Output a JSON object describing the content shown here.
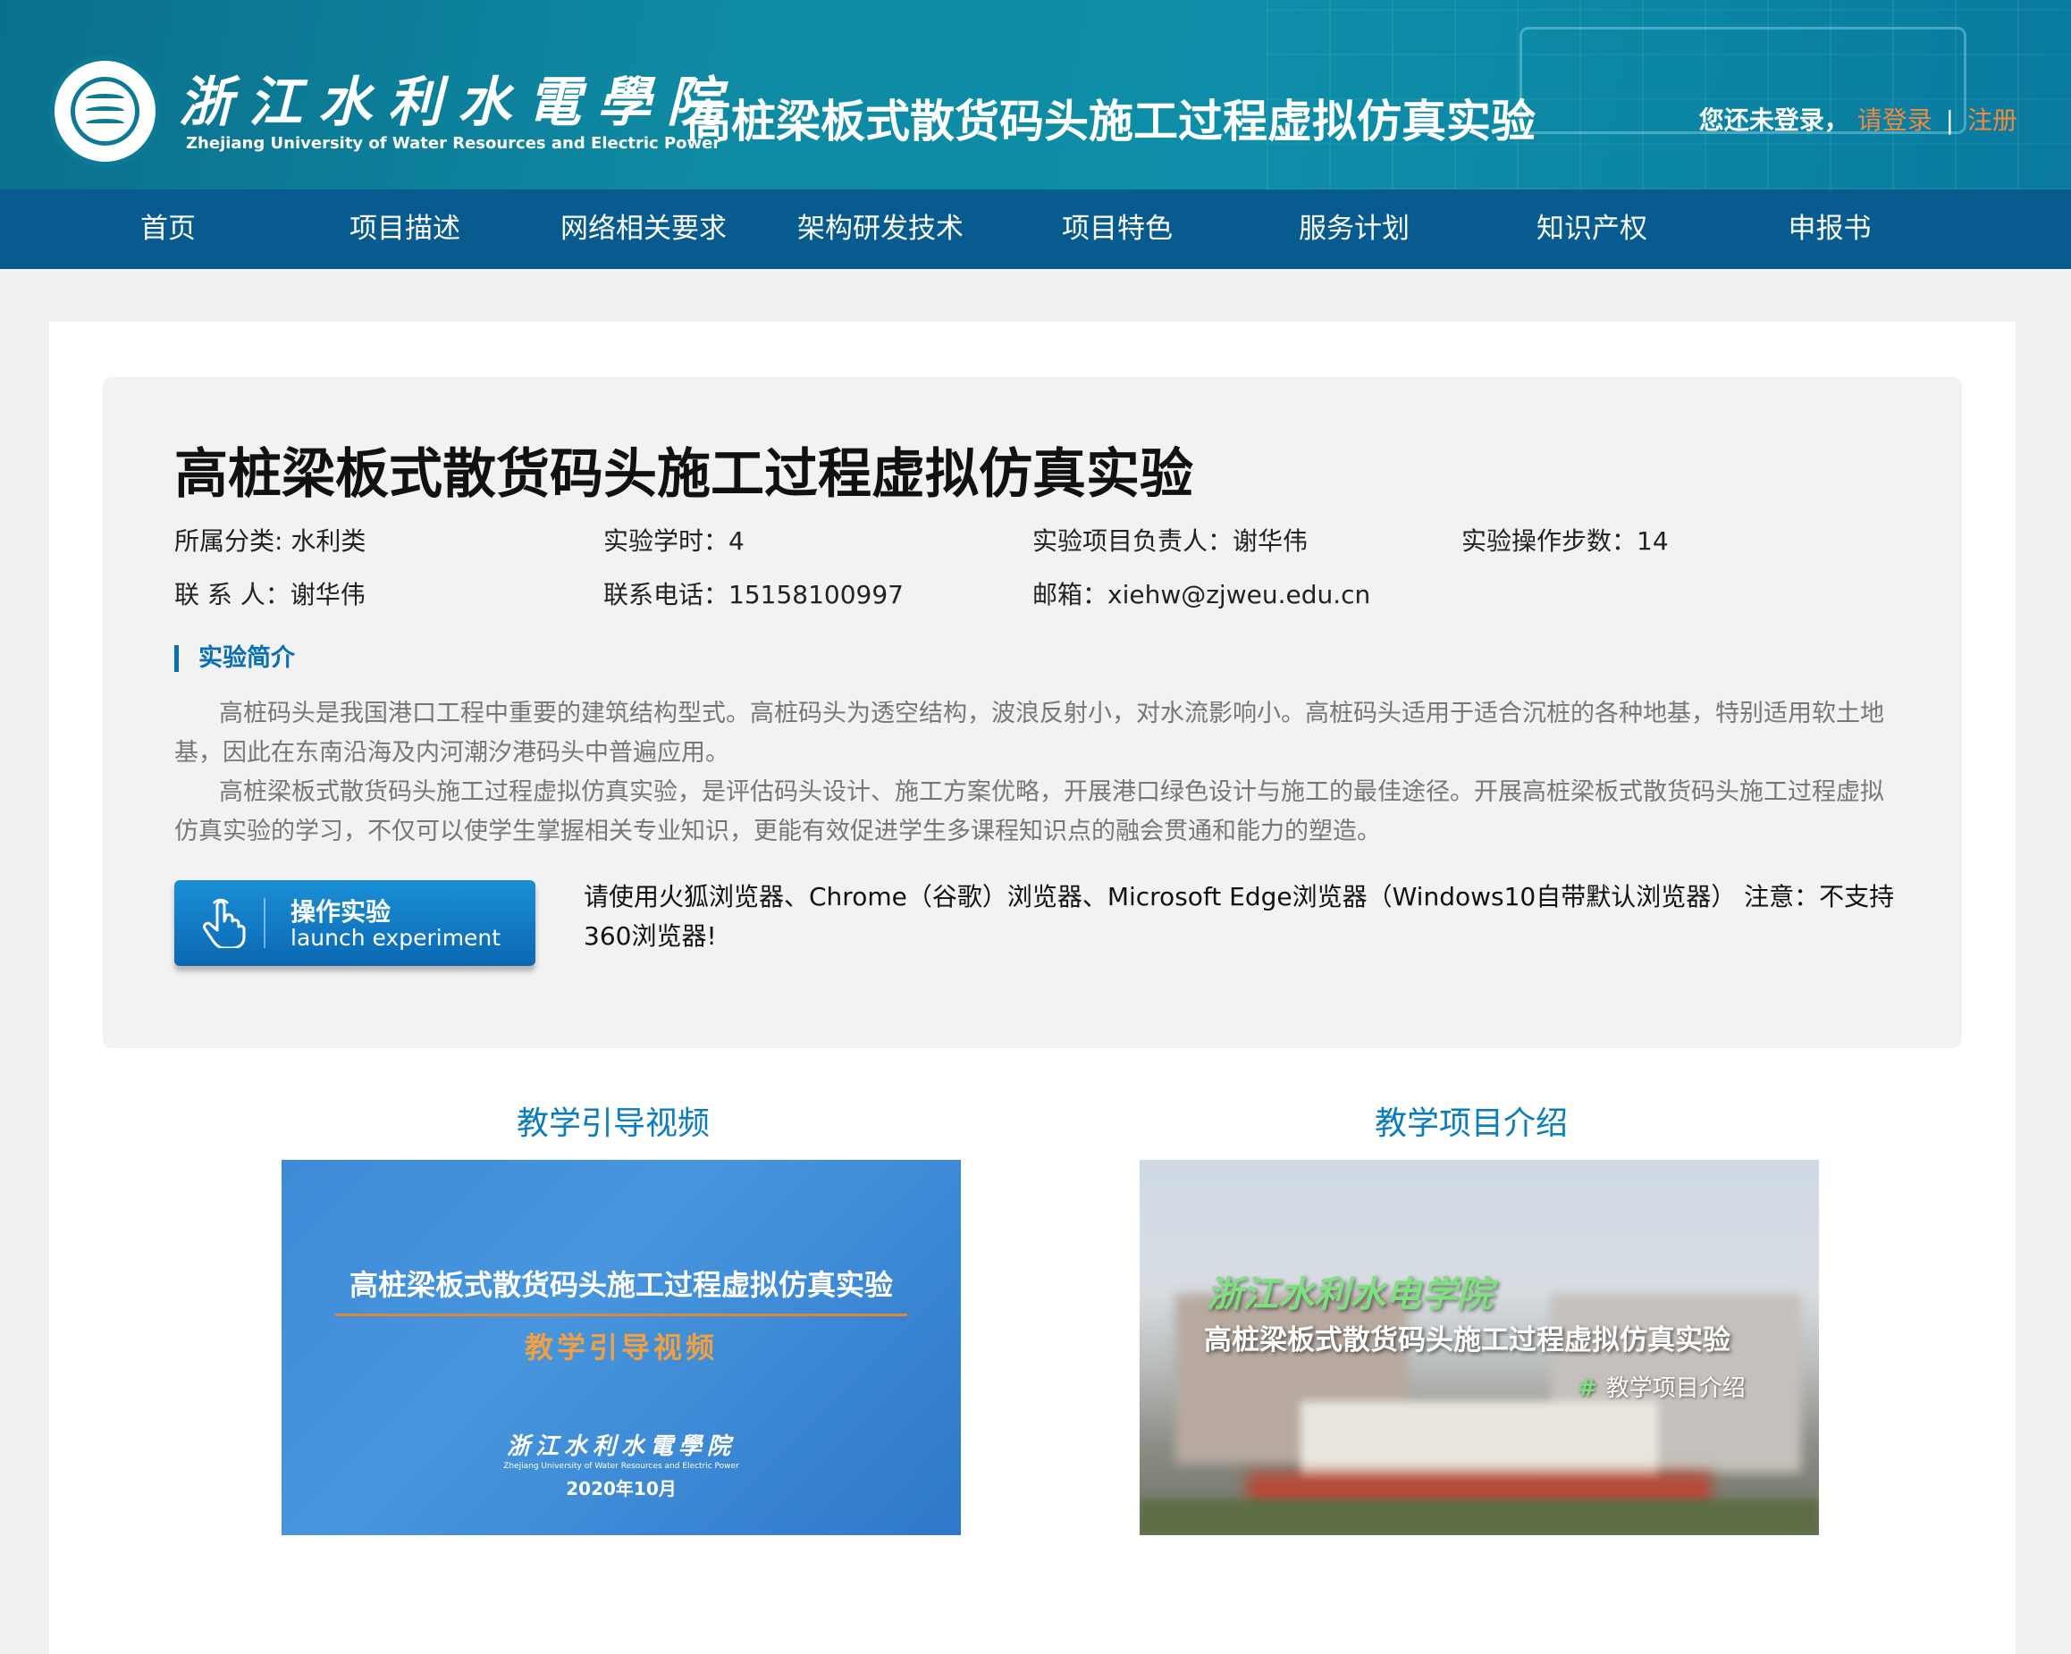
{
  "header": {
    "logo_cn": "浙江水利水電學院",
    "logo_en": "Zhejiang University of Water Resources and Electric Power",
    "site_title": "高桩梁板式散货码头施工过程虚拟仿真实验",
    "login_prompt": "您还未登录，",
    "login_link": "请登录",
    "separator": "|",
    "register_link": "注册"
  },
  "nav": {
    "items": [
      "首页",
      "项目描述",
      "网络相关要求",
      "架构研发技术",
      "项目特色",
      "服务计划",
      "知识产权",
      "申报书"
    ]
  },
  "experiment": {
    "title": "高桩梁板式散货码头施工过程虚拟仿真实验",
    "category": "所属分类: 水利类",
    "hours": "实验学时：4",
    "leader": "实验项目负责人：谢华伟",
    "steps": "实验操作步数：14",
    "contact": "联 系 人：谢华伟",
    "phone": "联系电话：15158100997",
    "email": "邮箱：xiehw@zjweu.edu.cn",
    "section_title": "实验简介",
    "intro_p1": "高桩码头是我国港口工程中重要的建筑结构型式。高桩码头为透空结构，波浪反射小，对水流影响小。高桩码头适用于适合沉桩的各种地基，特别适用软土地基，因此在东南沿海及内河潮汐港码头中普遍应用。",
    "intro_p2": "高桩梁板式散货码头施工过程虚拟仿真实验，是评估码头设计、施工方案优略，开展港口绿色设计与施工的最佳途径。开展高桩梁板式散货码头施工过程虚拟仿真实验的学习，不仅可以使学生掌握相关专业知识，更能有效促进学生多课程知识点的融会贯通和能力的塑造。",
    "launch_cn": "操作实验",
    "launch_en": "launch experiment",
    "browser_note": "请使用火狐浏览器、Chrome（谷歌）浏览器、Microsoft Edge浏览器（Windows10自带默认浏览器） 注意：不支持360浏览器!"
  },
  "media": {
    "video_heading": "教学引导视频",
    "video_thumb_title": "高桩梁板式散货码头施工过程虚拟仿真实验",
    "video_thumb_subtitle": "教学引导视频",
    "video_thumb_school": "浙江水利水電學院",
    "video_thumb_school_en": "Zhejiang University of Water Resources and Electric Power",
    "video_thumb_date": "2020年10月",
    "intro_heading": "教学项目介绍",
    "intro_thumb_school": "浙江水利水电学院",
    "intro_thumb_title": "高桩梁板式散货码头施工过程虚拟仿真实验",
    "intro_thumb_hash": "#",
    "intro_thumb_tag": "教学项目介绍"
  },
  "colors": {
    "header_bg": "#0e8ea8",
    "nav_bg": "#075b8f",
    "accent": "#0a7cc0",
    "login_link": "#f08a3c"
  }
}
